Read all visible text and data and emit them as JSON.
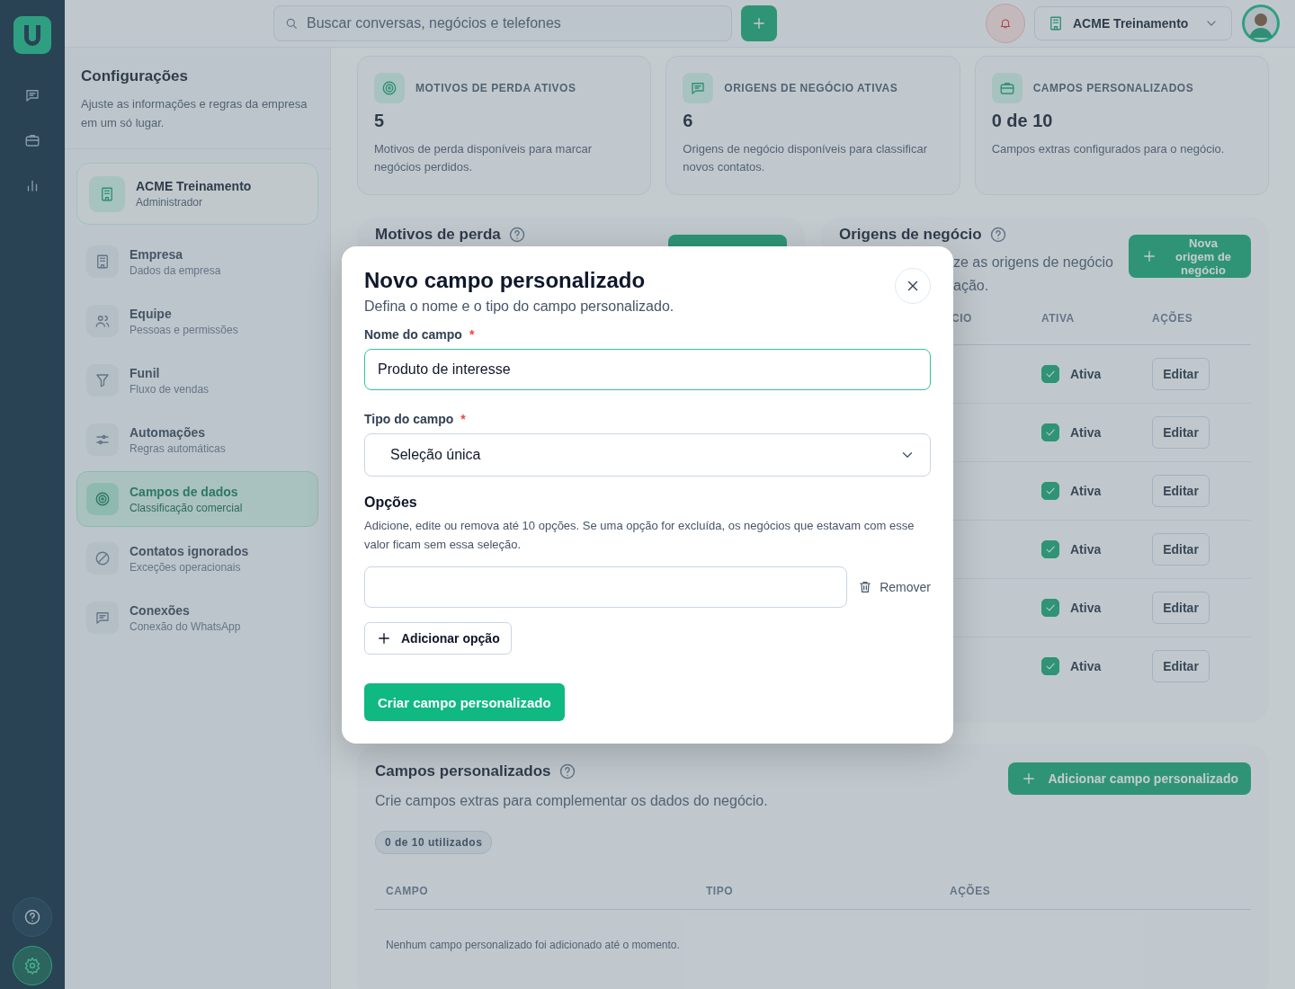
{
  "rail": {
    "items": [
      {
        "kind": "chat",
        "selected": false
      },
      {
        "kind": "briefcase",
        "selected": false
      },
      {
        "kind": "chart",
        "selected": false
      }
    ],
    "bottom": [
      {
        "kind": "help",
        "selected": false
      },
      {
        "kind": "settings",
        "selected": true
      }
    ]
  },
  "topbar": {
    "search": {
      "placeholder": "Buscar conversas, negócios e telefones"
    },
    "org": "ACME Treinamento"
  },
  "settings": {
    "title": "Configurações",
    "description": "Ajuste as informações e regras da empresa em um só lugar.",
    "org_card": {
      "name": "ACME Treinamento",
      "role": "Administrador"
    },
    "items": [
      {
        "kind": "building",
        "label": "Empresa",
        "sublabel": "Dados da empresa",
        "selected": false
      },
      {
        "kind": "people",
        "label": "Equipe",
        "sublabel": "Pessoas e permissões",
        "selected": false
      },
      {
        "kind": "funnel",
        "label": "Funil",
        "sublabel": "Fluxo de vendas",
        "selected": false
      },
      {
        "kind": "sliders",
        "label": "Automações",
        "sublabel": "Regras automáticas",
        "selected": false
      },
      {
        "kind": "target",
        "label": "Campos de dados",
        "sublabel": "Classificação comercial",
        "selected": true
      },
      {
        "kind": "blocked",
        "label": "Contatos ignorados",
        "sublabel": "Exceções operacionais",
        "selected": false
      },
      {
        "kind": "chat",
        "label": "Conexões",
        "sublabel": "Conexão do WhatsApp",
        "selected": false
      }
    ]
  },
  "stats": [
    {
      "kind": "target",
      "title": "MOTIVOS DE PERDA ATIVOS",
      "value": "5",
      "text": "Motivos de perda disponíveis para marcar negócios perdidos."
    },
    {
      "kind": "chat",
      "title": "ORIGENS DE NEGÓCIO ATIVAS",
      "value": "6",
      "text": "Origens de negócio disponíveis para classificar novos contatos."
    },
    {
      "kind": "briefcase",
      "title": "CAMPOS PERSONALIZADOS",
      "value": "0 de 10",
      "text": "Campos extras configurados para o negócio."
    }
  ],
  "loss_card": {
    "title": "Motivos de perda"
  },
  "origins_card": {
    "title": "Origens de negócio",
    "description_lines": [
      "ze as origens de negócio",
      "ação."
    ],
    "button": "Nova origem de negócio",
    "columns": [
      "CIO",
      "ATIVA",
      "AÇÕES"
    ],
    "rows": [
      {
        "checked": true,
        "status": "Ativa",
        "action": "Editar"
      },
      {
        "checked": true,
        "status": "Ativa",
        "action": "Editar"
      },
      {
        "checked": true,
        "status": "Ativa",
        "action": "Editar"
      },
      {
        "checked": true,
        "status": "Ativa",
        "action": "Editar"
      },
      {
        "checked": true,
        "status": "Ativa",
        "action": "Editar"
      },
      {
        "checked": true,
        "status": "Ativa",
        "action": "Editar"
      }
    ]
  },
  "custom_card": {
    "title": "Campos personalizados",
    "description": "Crie campos extras para complementar os dados do negócio.",
    "button": "Adicionar campo personalizado",
    "badge": "0 de 10 utilizados",
    "columns": [
      "CAMPO",
      "TIPO",
      "AÇÕES"
    ],
    "empty": "Nenhum campo personalizado foi adicionado até o momento."
  },
  "modal": {
    "title": "Novo campo personalizado",
    "subtitle": "Defina o nome e o tipo do campo personalizado.",
    "name_field": {
      "label": "Nome do campo",
      "mark": "*",
      "value": "Produto de interesse"
    },
    "type_field": {
      "label": "Tipo do campo",
      "mark": "*",
      "value": "Seleção única"
    },
    "options": {
      "title": "Opções",
      "text": "Adicione, edite ou remova até 10 opções. Se uma opção for excluída, os negócios que estavam com esse valor ficam sem essa seleção.",
      "items": [
        {
          "remove": "Remover"
        }
      ],
      "add": "Adicionar opção"
    },
    "submit": "Criar campo personalizado"
  }
}
